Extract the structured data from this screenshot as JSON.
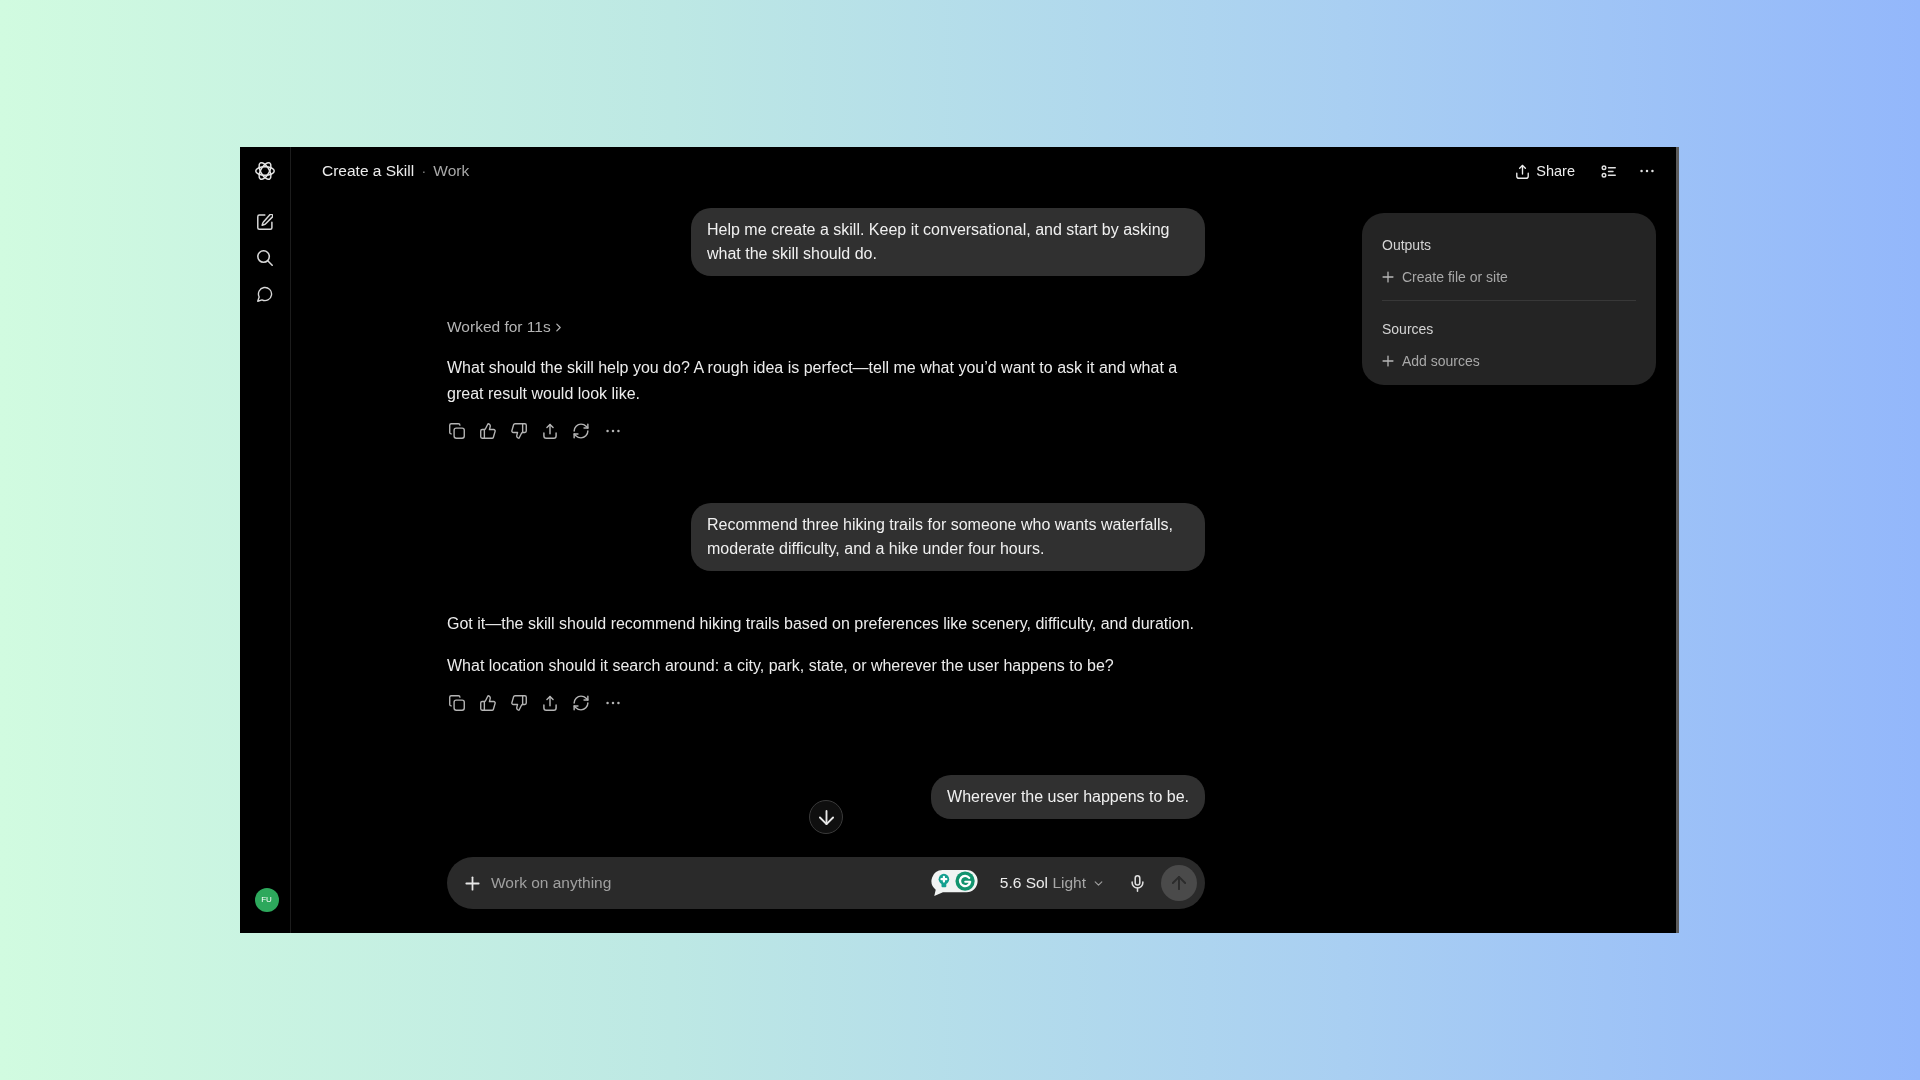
{
  "header": {
    "title": "Create a Skill",
    "separator": "·",
    "project": "Work",
    "share_label": "Share"
  },
  "sidebar": {
    "avatar_initials": "FU"
  },
  "messages": [
    {
      "kind": "user",
      "text": "Help me create a skill. Keep it conversational, and start by asking what the skill should do."
    },
    {
      "kind": "assistant",
      "status": "Worked for 11s",
      "paragraphs": [
        "What should the skill help you do? A rough idea is perfect—tell me what you’d want to ask it and what a great result would look like."
      ]
    },
    {
      "kind": "user",
      "text": "Recommend three hiking trails for someone who wants waterfalls, moderate difficulty, and a hike under four hours."
    },
    {
      "kind": "assistant",
      "paragraphs": [
        "Got it—the skill should recommend hiking trails based on preferences like scenery, difficulty, and duration.",
        "What location should it search around: a city, park, state, or wherever the user happens to be?"
      ]
    },
    {
      "kind": "user",
      "text": "Wherever the user happens to be."
    }
  ],
  "composer": {
    "placeholder": "Work on anything",
    "model": "5.6 Sol",
    "mode": "Light"
  },
  "side_panel": {
    "sections": [
      {
        "heading": "Outputs",
        "action": "Create file or site"
      },
      {
        "heading": "Sources",
        "action": "Add sources"
      }
    ]
  }
}
